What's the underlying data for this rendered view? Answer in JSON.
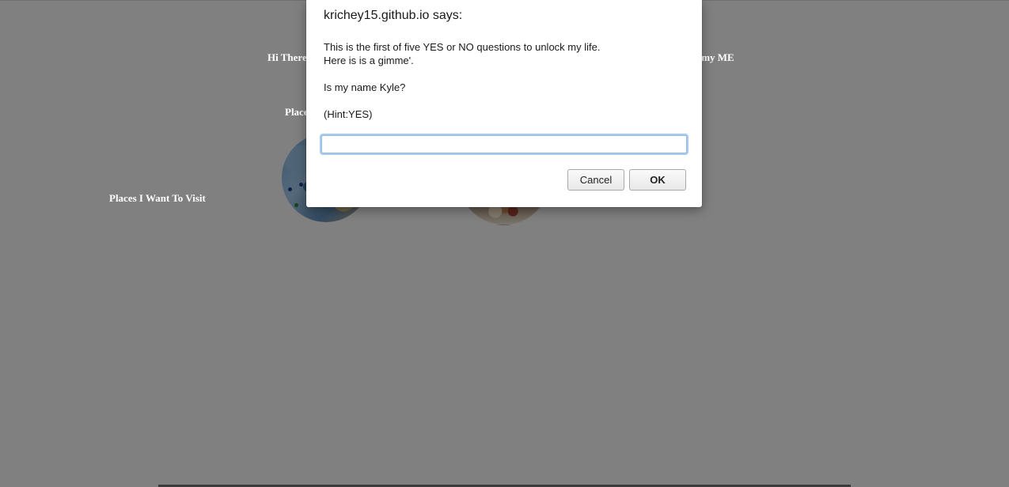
{
  "page": {
    "hi_text": "Hi There",
    "places_text": "Places",
    "me_text": "it my ME",
    "visit_text": "Places I Want To Visit"
  },
  "dialog": {
    "title": "krichey15.github.io says:",
    "message_lines": [
      "This is the first of five YES or NO questions to unlock my life.",
      "Here is is a gimme'.",
      "",
      "Is my name Kyle?",
      "",
      "(Hint:YES)"
    ],
    "input_value": "",
    "cancel_label": "Cancel",
    "ok_label": "OK"
  },
  "colors": {
    "overlay": "#808080",
    "dialog_bg": "#ffffff",
    "input_focus": "#a9ccf1"
  }
}
